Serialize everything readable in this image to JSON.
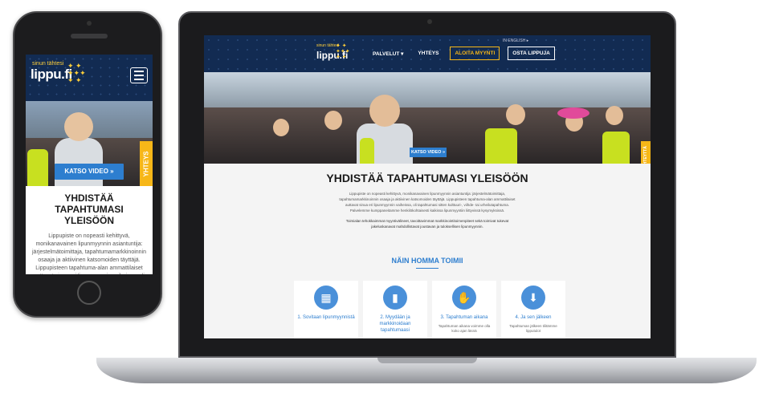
{
  "phone": {
    "logo_small": "sinun tähtesi",
    "logo_big": "lippu.fi",
    "video_button": "KATSO VIDEO »",
    "side_tab": "YHTEYS",
    "title": "YHDISTÄÄ TAPAHTUMASI YLEISÖÖN",
    "body": "Lippupiste on nopeasti kehittyvä, monikanavainen lipunmyynnin asiantuntija: järjestelmätoimittaja, tapahtumamarkkinoinnin osaaja ja aktiivinen katsomoiden täyttäjä. Lippupisteen tapahtuma-alan ammattilaiset auttavat sinua eri lipunmyynnin vaiheissa, oli tapahtumasi sitten kulttuuri-, viihde- tai urheilutapahtuma. Palvelemme kumppaneitamme henkilökohtaisesti kaikissa lipunmyyntiin"
  },
  "laptop": {
    "lang": "IN ENGLISH ▸",
    "logo_small": "sinun tähtesi",
    "logo_big": "lippu.fi",
    "nav": {
      "services": "PALVELUT ▾",
      "contact": "YHTEYS",
      "start_selling": "ALOITA MYYNTI",
      "buy_ticket": "OSTA LIPPUJA"
    },
    "video_button": "KATSO VIDEO »",
    "side_tab": "OTA YHTEYTTÄ",
    "title": "YHDISTÄÄ TAPAHTUMASI YLEISÖÖN",
    "body": "Lippupiste on nopeasti kehittyvä, monikanavainen lipunmyynnin asiantuntija: järjestelmätoimittaja, tapahtumamarkkinoinnin osaaja ja aktiivinen katsomoiden täyttäjä. Lippupisteen tapahtuma-alan ammattilaiset auttavat sinua eri lipunmyynnin vaiheissa, oli tapahtumasi sitten kulttuuri-, viihde- tai urheilutapahtuma. Palvelemme kumppaneitamme henkilökohtaisesti kaikissa lipunmyyntiin liittyvissä kysymyksissä.",
    "body2": "Toimialan tehokkaimmat myyntivälineet, tavoittavimmat markkinointitoimenpiteet sekä toimivat tukevat jakeluskanavat mahdollistavat joustavan ja tuloksellisen lipunmyynnin.",
    "how_title": "NÄIN HOMMA TOIMII",
    "steps": [
      {
        "label": "1. Sovitaan lipunmyynnistä",
        "text": "",
        "icon": "calendar-icon"
      },
      {
        "label": "2. Myydään ja markkinoidaan tapahtumaasi",
        "text": "",
        "icon": "ticket-icon"
      },
      {
        "label": "3. Tapahtuman aikana",
        "text": "Tapahtuman aikana voimme olla koko ajan läsnä",
        "icon": "hand-icon"
      },
      {
        "label": "4. Ja sen jälkeen",
        "text": "Tapahtuman jälkeen tilitämme lipputulot",
        "icon": "download-icon"
      }
    ]
  },
  "colors": {
    "header_navy": "#122b52",
    "accent_blue": "#2d7ecf",
    "accent_yellow": "#f7b718"
  }
}
